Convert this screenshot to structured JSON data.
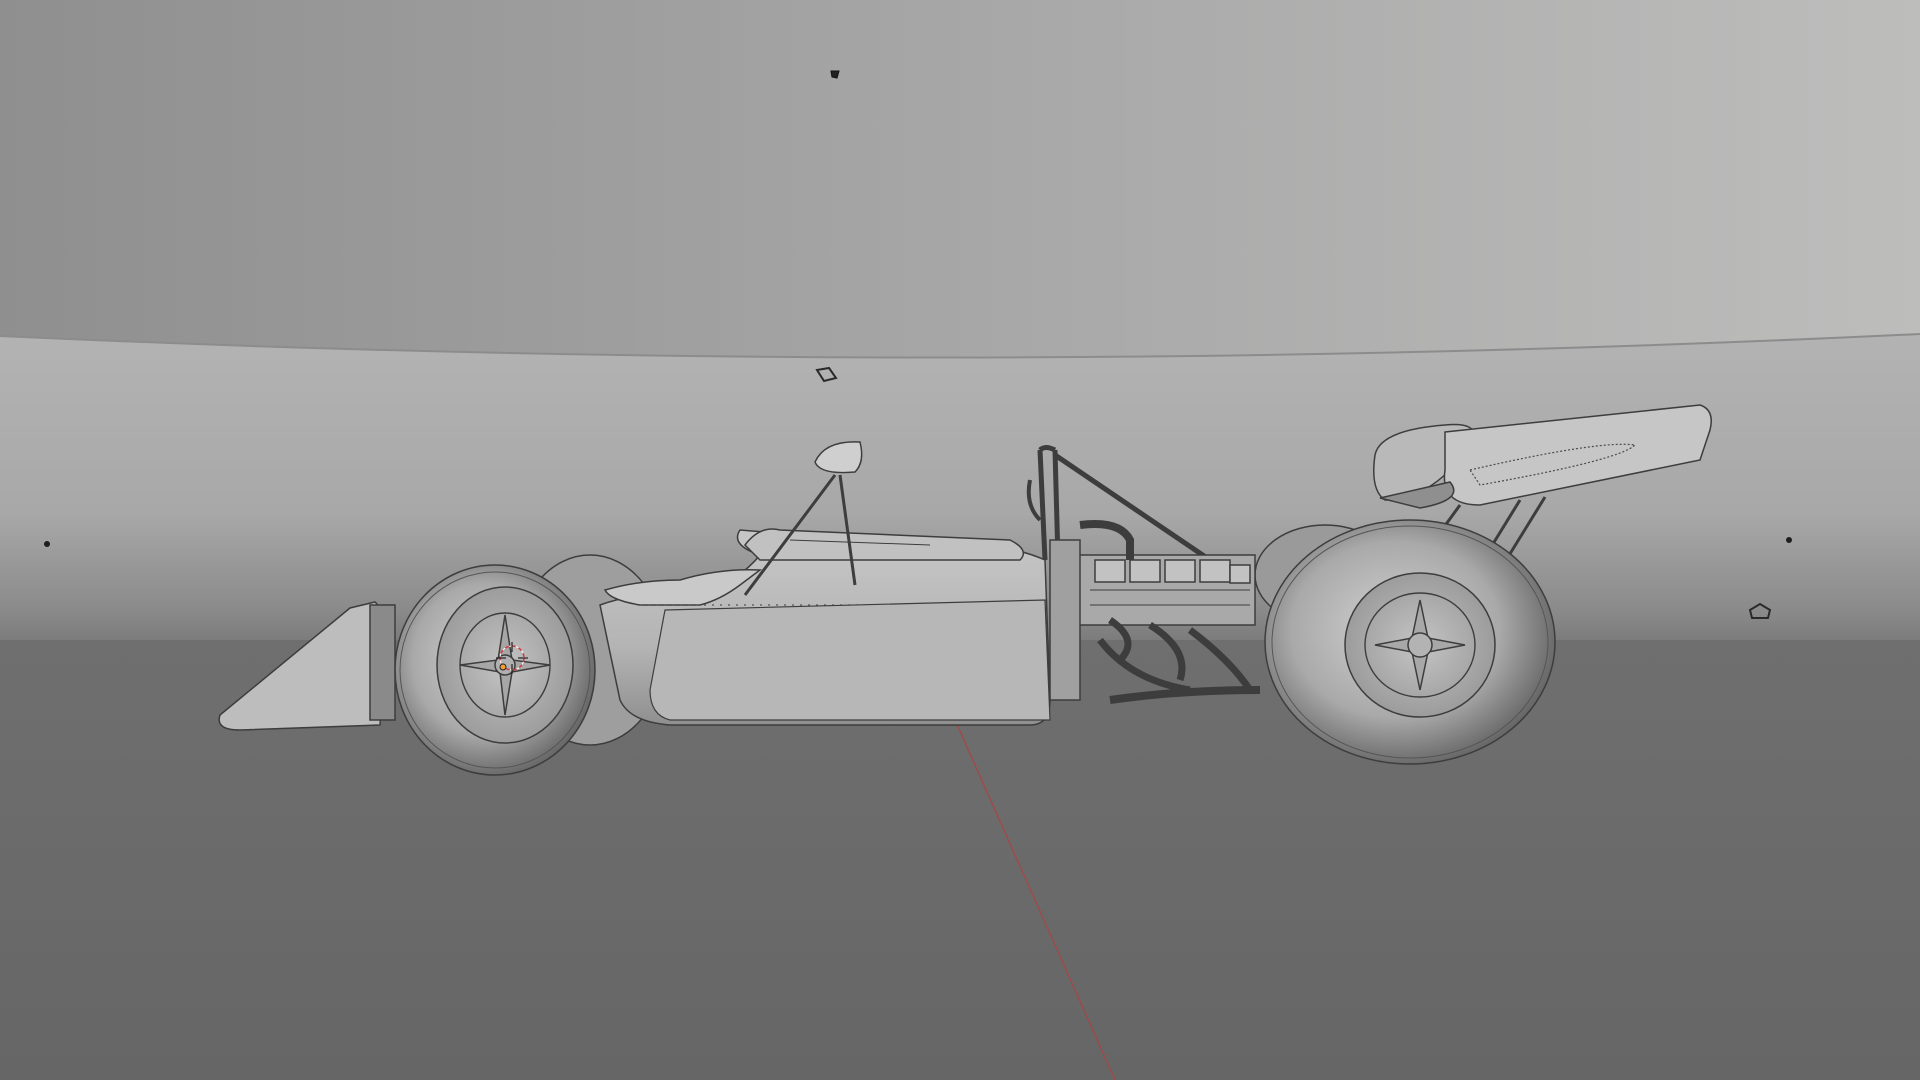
{
  "viewport": {
    "icons": {
      "light": "light-icon",
      "empty": "empty-object-icon",
      "cursor": "3d-cursor-icon",
      "origin": "object-origin-icon"
    },
    "colors": {
      "backdrop_top": "#9a9a9a",
      "backdrop_upper_light": "#b9bab9",
      "floor": "#6d6d6d",
      "model": "#bebebe",
      "model_shade": "#8e8e8e",
      "outline": "#3c3c3c",
      "axis_line": "#b04040",
      "cursor_ring": "#d03a3a"
    }
  }
}
